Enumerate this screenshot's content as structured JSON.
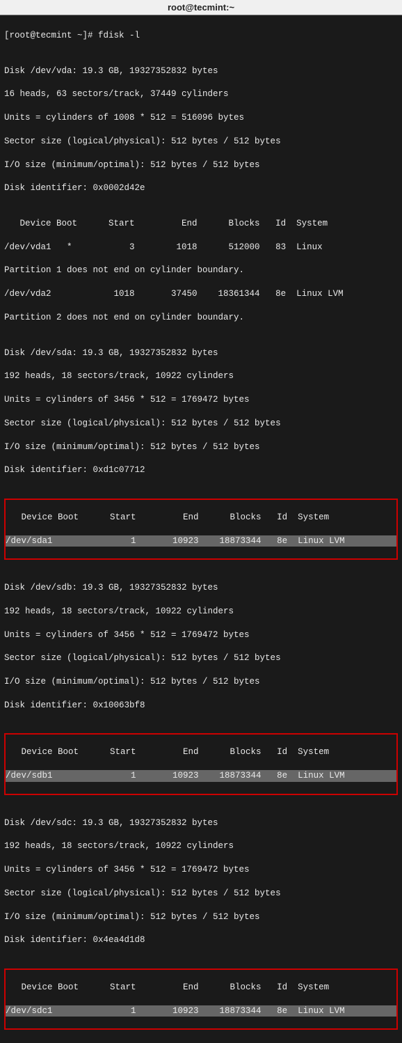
{
  "titlebar": "root@tecmint:~",
  "prompt": "[root@tecmint ~]# ",
  "command": "fdisk -l",
  "blank": "",
  "disk_vda": {
    "l1": "Disk /dev/vda: 19.3 GB, 19327352832 bytes",
    "l2": "16 heads, 63 sectors/track, 37449 cylinders",
    "l3": "Units = cylinders of 1008 * 512 = 516096 bytes",
    "l4": "Sector size (logical/physical): 512 bytes / 512 bytes",
    "l5": "I/O size (minimum/optimal): 512 bytes / 512 bytes",
    "l6": "Disk identifier: 0x0002d42e",
    "hdr": "   Device Boot      Start         End      Blocks   Id  System",
    "p1": "/dev/vda1   *           3        1018      512000   83  Linux",
    "w1": "Partition 1 does not end on cylinder boundary.",
    "p2": "/dev/vda2            1018       37450    18361344   8e  Linux LVM",
    "w2": "Partition 2 does not end on cylinder boundary."
  },
  "disk_sda": {
    "l1": "Disk /dev/sda: 19.3 GB, 19327352832 bytes",
    "l2": "192 heads, 18 sectors/track, 10922 cylinders",
    "l3": "Units = cylinders of 3456 * 512 = 1769472 bytes",
    "l4": "Sector size (logical/physical): 512 bytes / 512 bytes",
    "l5": "I/O size (minimum/optimal): 512 bytes / 512 bytes",
    "l6": "Disk identifier: 0xd1c07712",
    "hdr": "   Device Boot      Start         End      Blocks   Id  System",
    "p1": "/dev/sda1               1       10923    18873344   8e  Linux LVM"
  },
  "disk_sdb": {
    "l1": "Disk /dev/sdb: 19.3 GB, 19327352832 bytes",
    "l2": "192 heads, 18 sectors/track, 10922 cylinders",
    "l3": "Units = cylinders of 3456 * 512 = 1769472 bytes",
    "l4": "Sector size (logical/physical): 512 bytes / 512 bytes",
    "l5": "I/O size (minimum/optimal): 512 bytes / 512 bytes",
    "l6": "Disk identifier: 0x10063bf8",
    "hdr": "   Device Boot      Start         End      Blocks   Id  System",
    "p1": "/dev/sdb1               1       10923    18873344   8e  Linux LVM"
  },
  "disk_sdc": {
    "l1": "Disk /dev/sdc: 19.3 GB, 19327352832 bytes",
    "l2": "192 heads, 18 sectors/track, 10922 cylinders",
    "l3": "Units = cylinders of 3456 * 512 = 1769472 bytes",
    "l4": "Sector size (logical/physical): 512 bytes / 512 bytes",
    "l5": "I/O size (minimum/optimal): 512 bytes / 512 bytes",
    "l6": "Disk identifier: 0x4ea4d1d8",
    "hdr": "   Device Boot      Start         End      Blocks   Id  System",
    "p1": "/dev/sdc1               1       10923    18873344   8e  Linux LVM"
  }
}
